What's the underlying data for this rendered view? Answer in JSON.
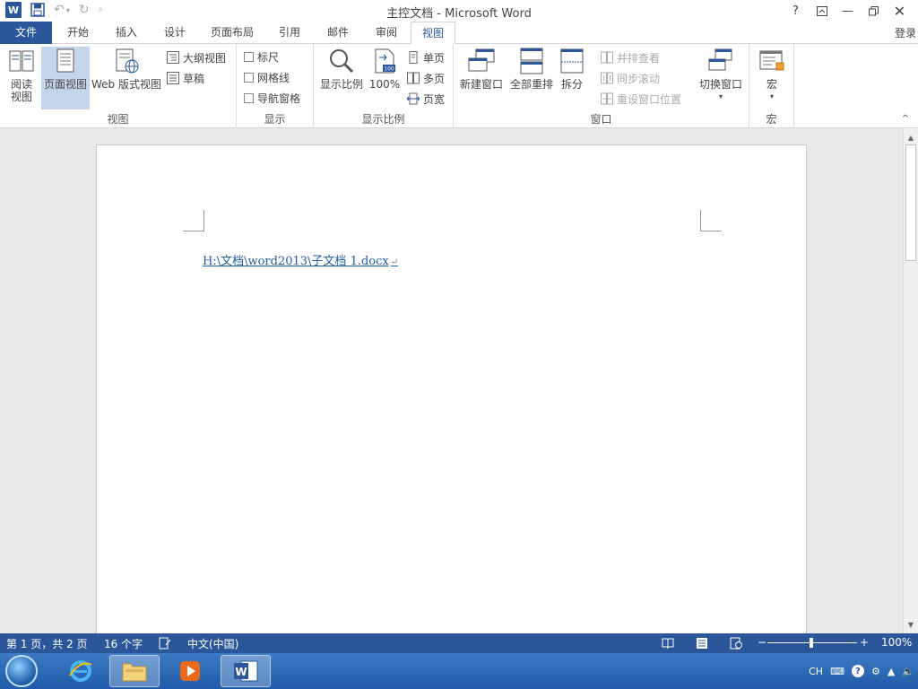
{
  "window": {
    "title": "主控文档 - Microsoft Word",
    "logo": "W",
    "controls": [
      "?",
      "restore-ribbon",
      "minimize",
      "restore",
      "close"
    ]
  },
  "qat": {
    "icons": [
      "word-logo-icon",
      "save-icon",
      "undo-icon",
      "redo-icon",
      "customize-icon"
    ]
  },
  "tabs": [
    {
      "label": "文件"
    },
    {
      "label": "开始"
    },
    {
      "label": "插入"
    },
    {
      "label": "设计"
    },
    {
      "label": "页面布局"
    },
    {
      "label": "引用"
    },
    {
      "label": "邮件"
    },
    {
      "label": "审阅"
    },
    {
      "label": "视图"
    }
  ],
  "active_tab": "视图",
  "login_label": "登录",
  "ribbon": {
    "view_group": {
      "label": "视图",
      "read_mode_line1": "阅读",
      "read_mode_line2": "视图",
      "print_layout": "页面视图",
      "web_layout": "Web 版式视图",
      "outline": "大纲视图",
      "draft": "草稿"
    },
    "show_group": {
      "label": "显示",
      "ruler": "标尺",
      "gridlines": "网格线",
      "nav_pane": "导航窗格"
    },
    "zoom_group": {
      "label": "显示比例",
      "zoom": "显示比例",
      "zoom_100": "100%",
      "one_page": "单页",
      "multi_page": "多页",
      "page_width": "页宽"
    },
    "window_group": {
      "label": "窗口",
      "new_window": "新建窗口",
      "arrange_all": "全部重排",
      "split": "拆分",
      "side_by_side": "并排查看",
      "sync_scroll": "同步滚动",
      "reset_position": "重设窗口位置",
      "switch_windows": "切换窗口"
    },
    "macro_group": {
      "label": "宏",
      "macros": "宏"
    }
  },
  "document": {
    "link_text": "H:\\文档\\word2013\\子文档 1.docx",
    "para_mark": "↵"
  },
  "status": {
    "page": "第 1 页，共 2 页",
    "words": "16 个字",
    "language": "中文(中国)",
    "zoom": "100%",
    "zoom_minus": "−",
    "zoom_plus": "+"
  },
  "tray": {
    "lang": "CH"
  },
  "colors": {
    "accent": "#2b579a",
    "link": "#1f5fa6"
  }
}
